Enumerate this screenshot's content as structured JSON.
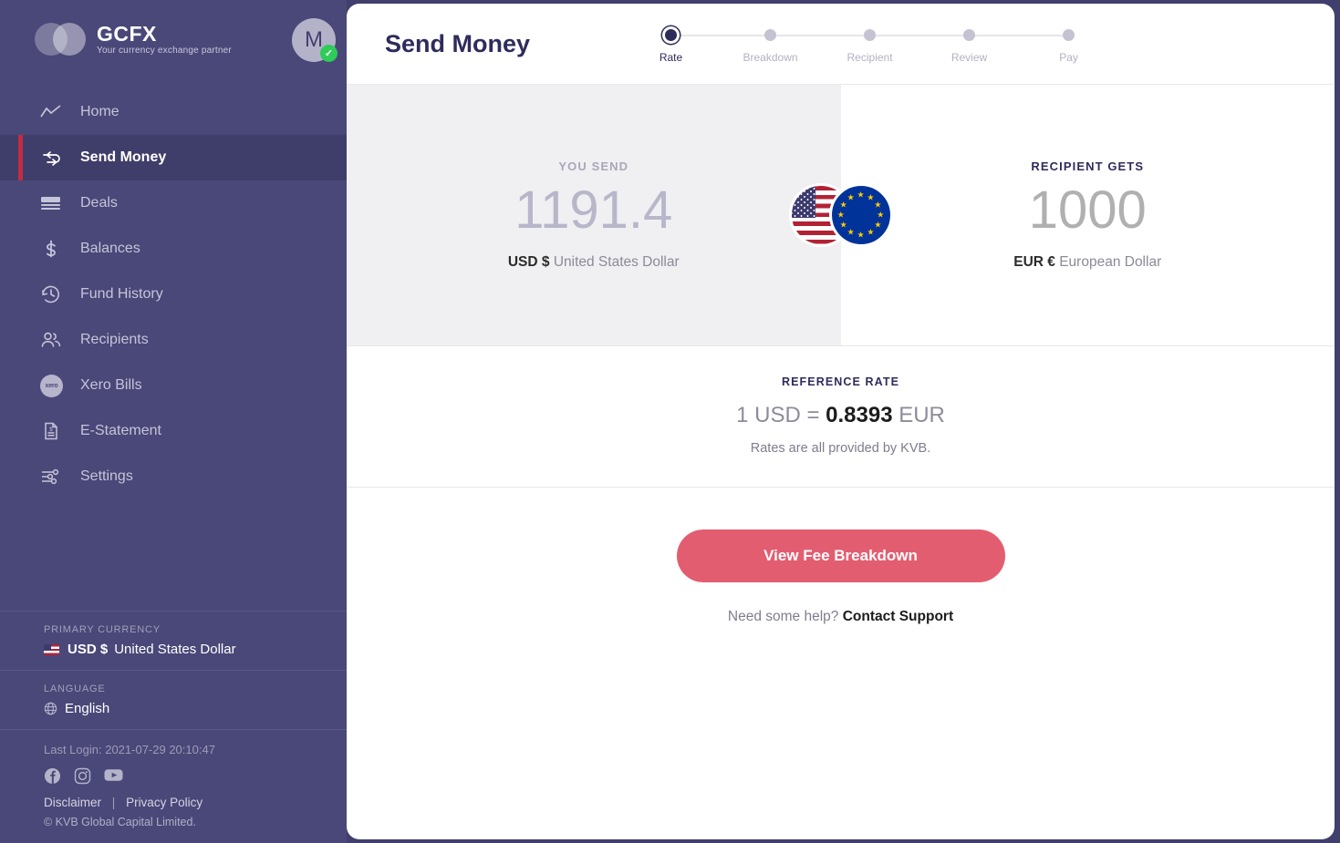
{
  "brand": {
    "name": "GCFX",
    "tagline": "Your currency exchange partner",
    "avatar_initial": "M",
    "verified_mark": "✓"
  },
  "sidebar": {
    "items": [
      {
        "label": "Home",
        "icon": "trend-line-icon",
        "active": false
      },
      {
        "label": "Send Money",
        "icon": "exchange-arrows-icon",
        "active": true
      },
      {
        "label": "Deals",
        "icon": "card-stack-icon",
        "active": false
      },
      {
        "label": "Balances",
        "icon": "dollar-sign-icon",
        "active": false
      },
      {
        "label": "Fund History",
        "icon": "clock-history-icon",
        "active": false
      },
      {
        "label": "Recipients",
        "icon": "people-icon",
        "active": false
      },
      {
        "label": "Xero Bills",
        "icon": "xero-badge-icon",
        "active": false
      },
      {
        "label": "E-Statement",
        "icon": "document-dollar-icon",
        "active": false
      },
      {
        "label": "Settings",
        "icon": "sliders-icon",
        "active": false
      }
    ],
    "xero_badge_text": "xero",
    "primary_currency": {
      "label": "PRIMARY CURRENCY",
      "code": "USD $",
      "name": "United States Dollar",
      "flag": "us-flag-icon"
    },
    "language": {
      "label": "LANGUAGE",
      "value": "English",
      "icon": "globe-icon"
    },
    "footer": {
      "last_login": "Last Login: 2021-07-29 20:10:47",
      "socials": [
        "facebook-icon",
        "instagram-icon",
        "youtube-icon"
      ],
      "disclaimer": "Disclaimer",
      "separator": "|",
      "privacy": "Privacy Policy",
      "copyright": "© KVB Global Capital Limited."
    }
  },
  "main": {
    "title": "Send Money",
    "steps": [
      {
        "label": "Rate",
        "active": true
      },
      {
        "label": "Breakdown",
        "active": false
      },
      {
        "label": "Recipient",
        "active": false
      },
      {
        "label": "Review",
        "active": false
      },
      {
        "label": "Pay",
        "active": false
      }
    ],
    "send": {
      "caption": "YOU SEND",
      "amount": "1191.4",
      "code": "USD $",
      "name": "United States Dollar",
      "flag": "us-flag-icon"
    },
    "receive": {
      "caption": "RECIPIENT GETS",
      "amount": "1000",
      "code": "EUR €",
      "name": "European Dollar",
      "flag": "eu-flag-icon"
    },
    "reference": {
      "caption": "REFERENCE RATE",
      "from": "1 USD =",
      "rate": "0.8393",
      "to": "EUR",
      "note": "Rates are all provided by KVB."
    },
    "cta_label": "View Fee Breakdown",
    "help_text": "Need some help?",
    "help_link": "Contact Support"
  },
  "colors": {
    "sidebar": "#4a4878",
    "sidebar_active": "#3f3d69",
    "accent_red": "#c32b40",
    "cta_pink": "#e35d70",
    "navy": "#2e2c5c",
    "panel_gray": "#f0f0f2",
    "verified_green": "#2ecc58"
  }
}
